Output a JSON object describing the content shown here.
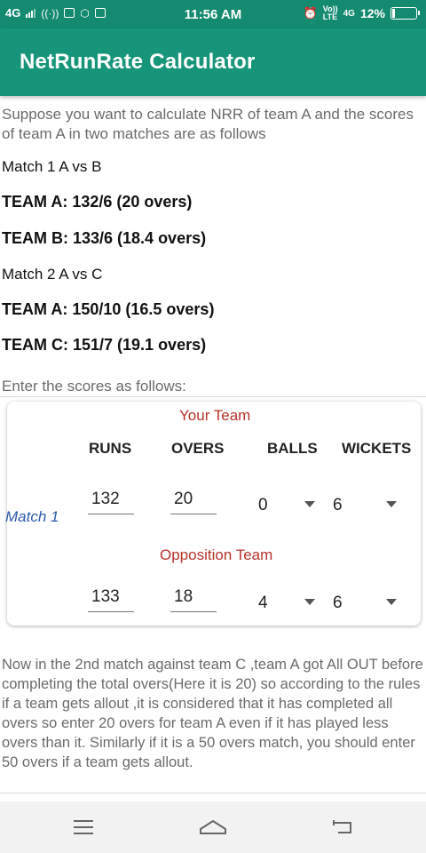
{
  "status_bar": {
    "network": "4G",
    "time": "11:56 AM",
    "network2": "4G",
    "volte_top": "Vo))",
    "volte_bottom": "LTE",
    "battery": "12%",
    "battery_level": 0.12
  },
  "app_bar": {
    "title": "NetRunRate Calculator"
  },
  "content": {
    "intro": "Suppose you want to calculate NRR of team A and the scores of team A in two matches are as follows",
    "match1_title": "Match 1 A vs B",
    "match1_team_a": "TEAM A: 132/6 (20 overs)",
    "match1_team_b": "TEAM B: 133/6 (18.4 overs)",
    "match2_title": "Match 2 A vs C",
    "match2_team_a": "TEAM A: 150/10 (16.5 overs)",
    "match2_team_c": "TEAM C: 151/7 (19.1 overs)",
    "enter_scores": "Enter the scores as follows:",
    "note": "Now in the 2nd match against team C ,team A got All OUT before completing the total overs(Here it is 20) so according to the rules if a team gets allout ,it is considered that it has completed all overs so enter 20 overs for team A even if it has played less overs than it. Similarly if it is a 50 overs match, you should enter 50 overs if a team gets allout."
  },
  "card": {
    "your_team_label": "Your Team",
    "opposition_label": "Opposition Team",
    "match_label": "Match 1",
    "columns": [
      "RUNS",
      "OVERS",
      "BALLS",
      "WICKETS"
    ],
    "your_team": {
      "runs": "132",
      "overs": "20",
      "balls": "0",
      "wickets": "6"
    },
    "opposition": {
      "runs": "133",
      "overs": "18",
      "balls": "4",
      "wickets": "6"
    }
  },
  "nav": {
    "menu_icon": "menu-icon",
    "home_icon": "home-icon",
    "back_icon": "back-icon"
  },
  "colors": {
    "status_bar": "#148a70",
    "app_bar": "#16957b",
    "team_label": "#b5332a",
    "match_label": "#2a5aa8"
  }
}
